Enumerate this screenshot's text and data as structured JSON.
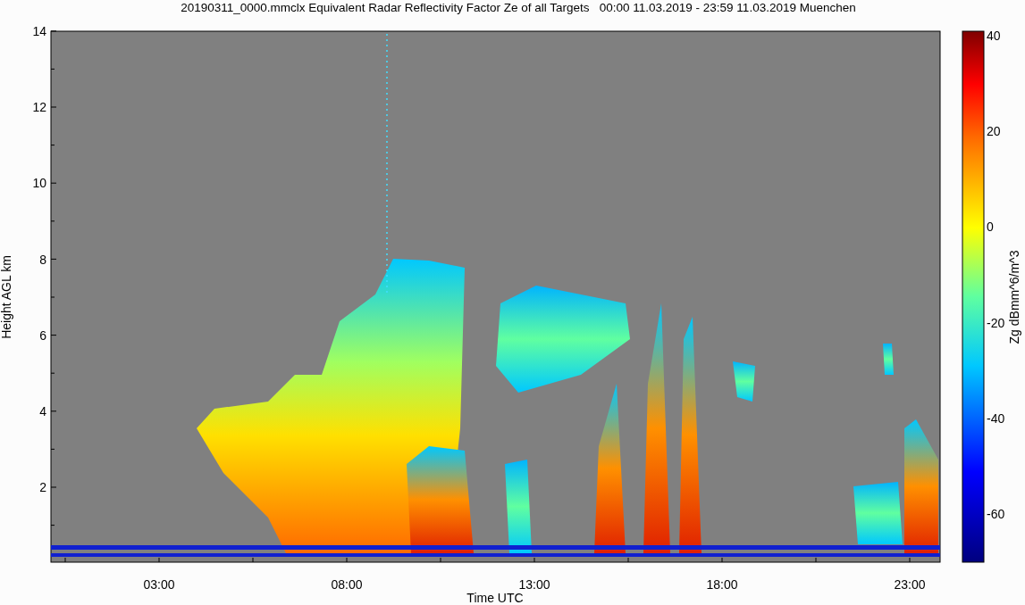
{
  "title": "20190311_0000.mmclx Equivalent Radar Reflectivity Factor Ze of all Targets   00:00 11.03.2019 - 23:59 11.03.2019 Muenchen",
  "y_axis": {
    "label": "Height AGL km",
    "ticks": [
      "14",
      "12",
      "10",
      "8",
      "6",
      "4",
      "2"
    ]
  },
  "x_axis": {
    "label": "Time UTC",
    "ticks": [
      "03:00",
      "08:00",
      "13:00",
      "18:00",
      "23:00"
    ]
  },
  "colorbar": {
    "label": "Zg dBmm^6/m^3",
    "ticks": [
      "40",
      "20",
      "0",
      "-20",
      "-40",
      "-60"
    ]
  }
}
